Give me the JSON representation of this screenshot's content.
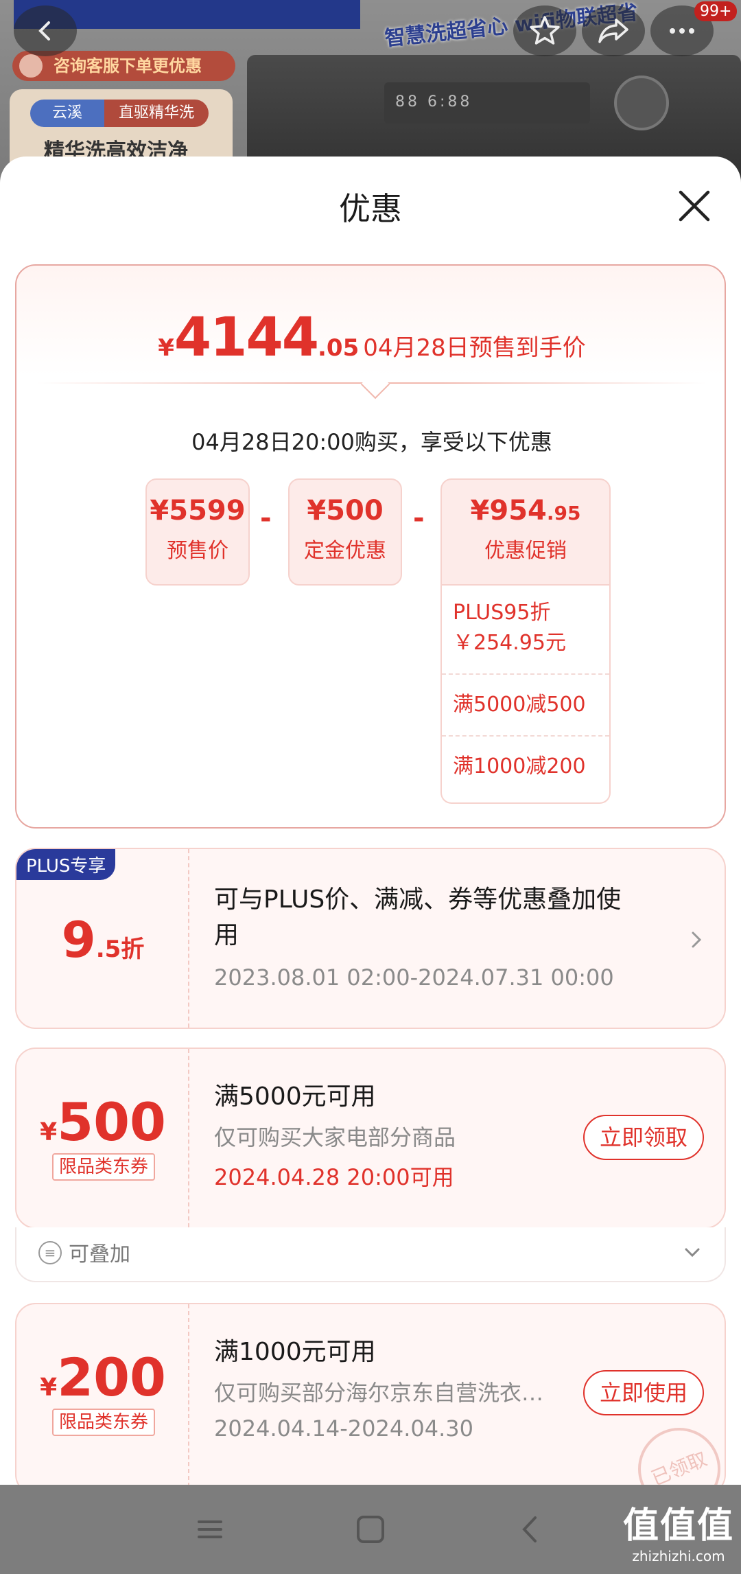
{
  "banner": {
    "consult_text": "咨询客服下单更优惠",
    "slogan": "智慧洗超省心 wifi物联超省",
    "tag_a": "云溪",
    "tag_b": "直驱精华洗",
    "card_text": "精华洗高效洁净",
    "badge": "99+"
  },
  "sheet": {
    "title": "优惠"
  },
  "summary": {
    "yen": "¥",
    "price_int": "4144",
    "price_dec": ".05",
    "price_desc": "04月28日预售到手价",
    "buy_time": "04月28日20:00购买，享受以下优惠",
    "presale": {
      "value": "¥5599",
      "label": "预售价"
    },
    "deposit": {
      "value": "¥500",
      "label": "定金优惠"
    },
    "promo": {
      "value_int": "¥954",
      "value_dec": ".95",
      "label": "优惠促销"
    },
    "promo_items": [
      "PLUS95折\n￥254.95元",
      "满5000减500",
      "满1000减200"
    ]
  },
  "plus_coupon": {
    "tag": "PLUS专享",
    "disc_int": "9",
    "disc_suffix": ".5折",
    "title": "可与PLUS价、满减、券等优惠叠加使用",
    "date": "2023.08.01 02:00-2024.07.31 00:00"
  },
  "coupon1": {
    "yen": "¥",
    "amount": "500",
    "tag": "限品类东券",
    "title": "满5000元可用",
    "sub": "仅可购买大家电部分商品",
    "date": "2024.04.28 20:00可用",
    "button": "立即领取"
  },
  "stack_row": {
    "text": "可叠加"
  },
  "coupon2": {
    "yen": "¥",
    "amount": "200",
    "tag": "限品类东券",
    "title": "满1000元可用",
    "sub": "仅可购买部分海尔京东自营洗衣…",
    "date": "2024.04.14-2024.04.30",
    "button": "立即使用",
    "stamp": "已领取"
  },
  "watermark": {
    "main": "值值值",
    "sub": "zhizhizhi.com"
  },
  "colors": {
    "accent": "#e0322b",
    "plus_blue": "#2a3a9b"
  }
}
